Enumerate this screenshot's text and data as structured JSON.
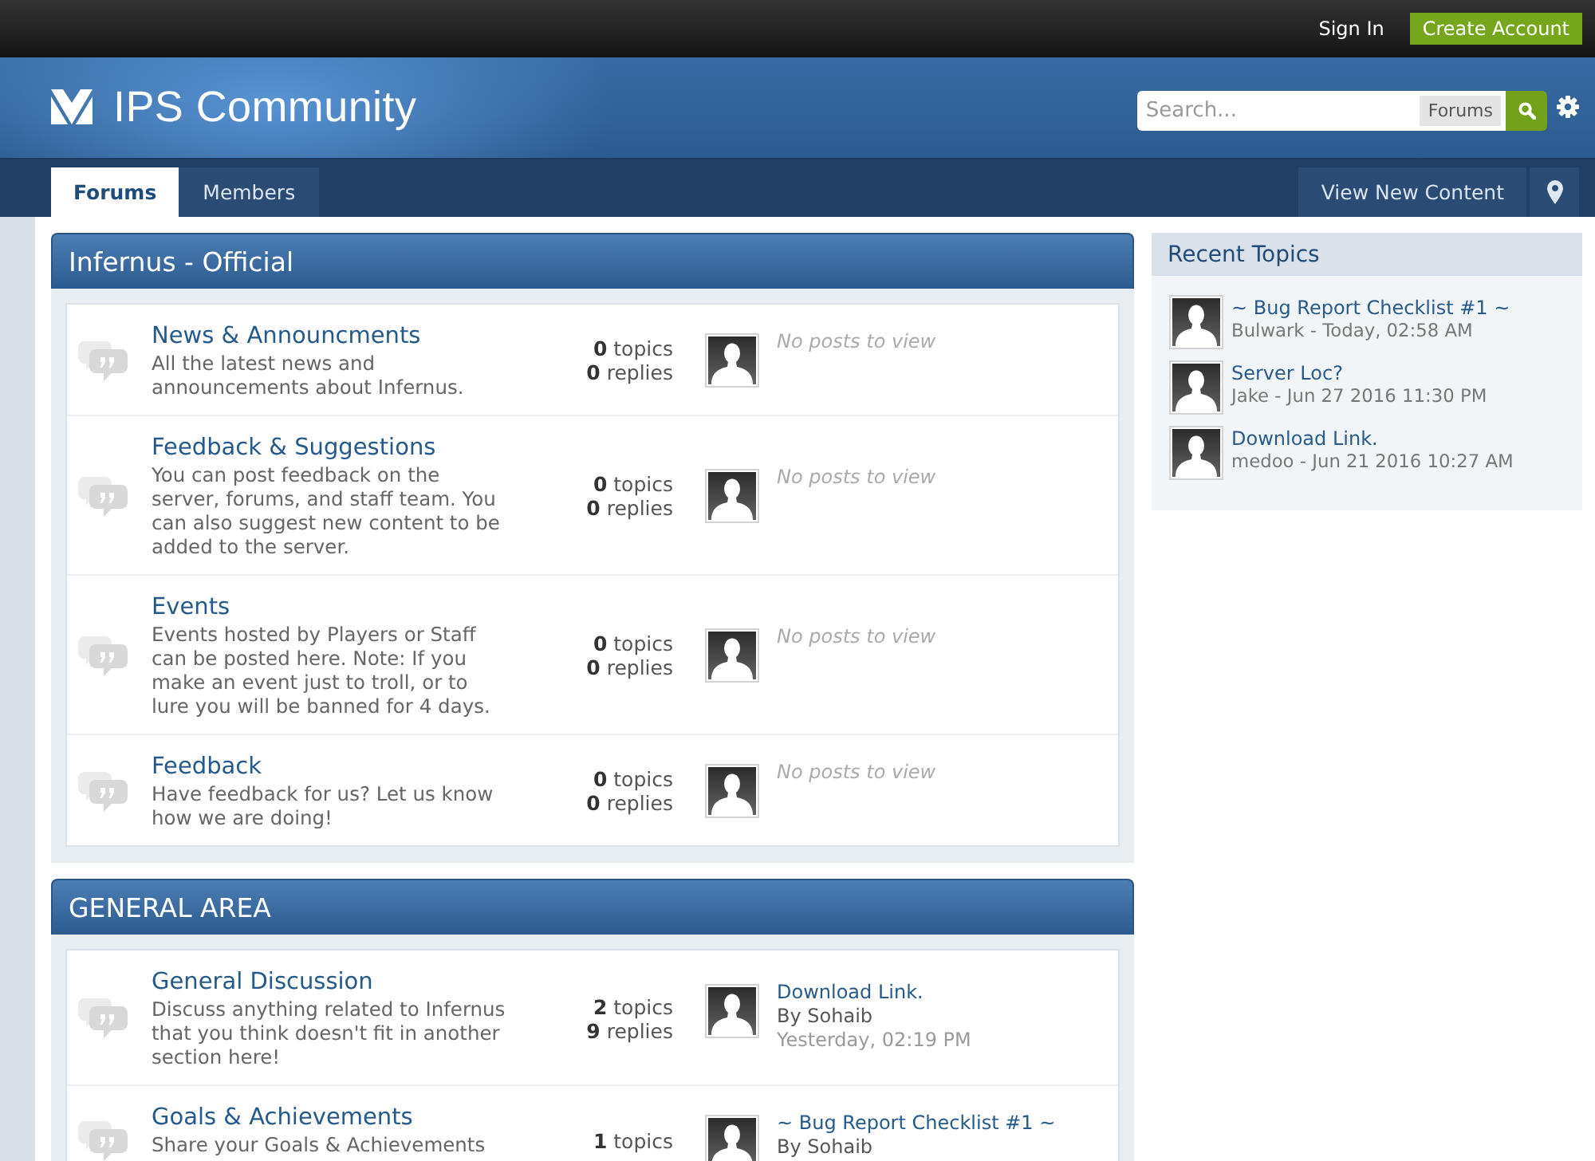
{
  "top_bar": {
    "links": [
      {
        "kind": "link",
        "label": "Sign In"
      },
      {
        "kind": "button",
        "label": "Create Account"
      }
    ]
  },
  "header": {
    "site_title": "IPS Community",
    "search": {
      "placeholder": "Search...",
      "scope": "Forums"
    }
  },
  "nav": {
    "tabs": [
      {
        "label": "Forums",
        "selected": true
      },
      {
        "label": "Members",
        "selected": false
      }
    ],
    "links": [
      {
        "label": "View New Content"
      }
    ]
  },
  "categories": [
    {
      "title": "Infernus - Official",
      "forums": [
        {
          "title": "News & Announcments",
          "description": "All the latest news and announcements about Infernus.",
          "topics": "**0** topics",
          "replies": "**0** replies",
          "last_post": {
            "kind": "empty",
            "text": "No posts to view"
          }
        },
        {
          "title": "Feedback & Suggestions",
          "description": "You can post feedback on the server, forums, and staff team. You can also suggest new content to be added to the server.",
          "topics": "**0** topics",
          "replies": "**0** replies",
          "last_post": {
            "kind": "empty",
            "text": "No posts to view"
          }
        },
        {
          "title": "Events",
          "description": "Events hosted by Players or Staff can be posted here. Note: If you make an event just to troll, or to lure you will be banned for 4 days.",
          "topics": "**0** topics",
          "replies": "**0** replies",
          "last_post": {
            "kind": "empty",
            "text": "No posts to view"
          }
        },
        {
          "title": "Feedback",
          "description": "Have feedback for us? Let us know how we are doing!",
          "topics": "**0** topics",
          "replies": "**0** replies",
          "last_post": {
            "kind": "empty",
            "text": "No posts to view"
          }
        }
      ]
    },
    {
      "title": "GENERAL AREA",
      "forums": [
        {
          "title": "General Discussion",
          "description": "Discuss anything related to Infernus that you think doesn't fit in another section here!",
          "topics": "**2** topics",
          "replies": "**9** replies",
          "last_post": {
            "kind": "post",
            "title": "Download Link.",
            "author": "By Sohaib",
            "time": "Yesterday, 02:19 PM"
          }
        },
        {
          "title": "Goals & Achievements",
          "description": "Share your Goals & Achievements",
          "topics": "**1** topics",
          "last_post": {
            "kind": "post",
            "title": "~ Bug Report Checklist #1 ~",
            "author": "By Sohaib"
          }
        }
      ]
    }
  ],
  "recent_topics": {
    "title": "Recent Topics",
    "items": [
      {
        "title": "~ Bug Report Checklist #1 ~",
        "meta": "Bulwark - Today, 02:58 AM"
      },
      {
        "title": "Server Loc?",
        "meta": "Jake - Jun 27 2016 11:30 PM"
      },
      {
        "title": "Download Link.",
        "meta": "medoo - Jun 21 2016 10:27 AM"
      }
    ]
  }
}
